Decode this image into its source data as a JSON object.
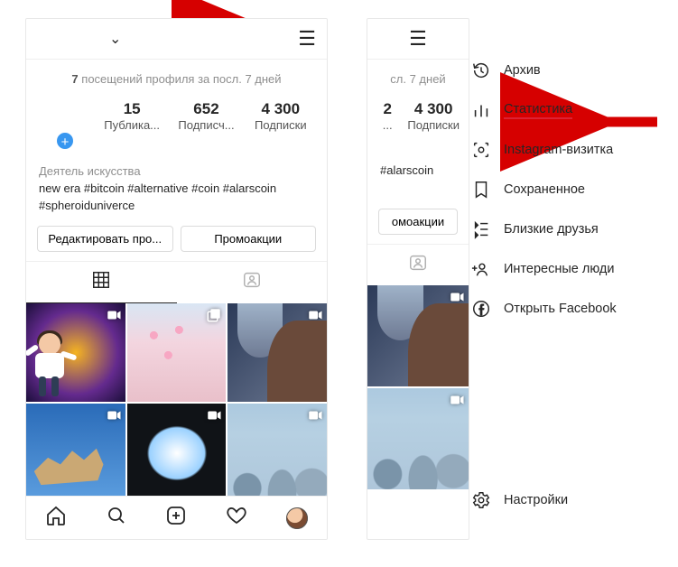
{
  "insights": {
    "count": "7",
    "label": "посещений профиля за посл. 7 дней",
    "label_short": "сл. 7 дней"
  },
  "stats": {
    "posts": {
      "num": "15",
      "label": "Публика..."
    },
    "followers": {
      "num": "652",
      "label": "Подписч..."
    },
    "following": {
      "num": "4 300",
      "label": "Подписки"
    },
    "following2": {
      "num": "4 300",
      "label": "Подписки"
    },
    "followers2": {
      "num": "2",
      "label": "..."
    }
  },
  "bio": {
    "category": "Деятель искусства",
    "line1": "new era #bitcoin #alternative #coin #alarscoin",
    "line2": "#spheroidunivеrce",
    "line1_short": "#alarscoin"
  },
  "buttons": {
    "edit": "Редактировать про...",
    "promo": "Промоакции",
    "promo_short": "омоакции"
  },
  "menu": {
    "archive": "Архив",
    "stats": "Статистика",
    "nametag": "Instagram-визитка",
    "saved": "Сохраненное",
    "close": "Близкие друзья",
    "discover": "Интересные люди",
    "facebook": "Открыть Facebook",
    "settings": "Настройки"
  }
}
